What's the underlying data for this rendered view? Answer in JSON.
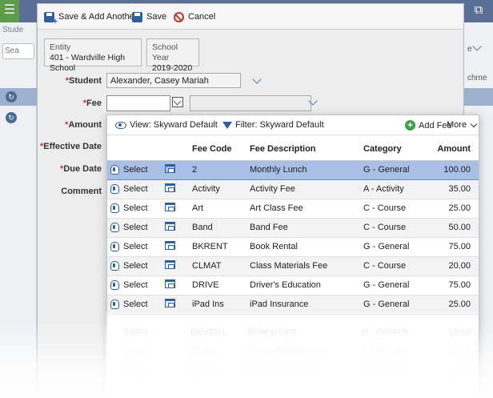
{
  "background": {
    "left_label": "Stude",
    "left_search_placeholder": "Sea",
    "right_top_text": "e",
    "right_mid_text": "chme"
  },
  "toolbar": {
    "save_add_another_label": "Save & Add Another",
    "save_label": "Save",
    "cancel_label": "Cancel"
  },
  "entity": {
    "label": "Entity",
    "value": "401 - Wardville High School"
  },
  "school_year": {
    "label": "School Year",
    "value": "2019-2020"
  },
  "form": {
    "student_label": "Student",
    "student_value": "Alexander, Casey Mariah",
    "fee_label": "Fee",
    "amount_label": "Amount",
    "effective_date_label": "Effective Date",
    "due_date_label": "Due Date",
    "comment_label": "Comment",
    "required_mark": "*"
  },
  "popup": {
    "view_label": "View: Skyward Default",
    "filter_label": "Filter: Skyward Default",
    "add_fee_label": "Add Fee",
    "more_label": "More",
    "columns": [
      "",
      "",
      "Fee Code",
      "Fee Description",
      "Category",
      "Amount"
    ],
    "select_label": "Select",
    "rows": [
      {
        "code": "2",
        "description": "Monthly Lunch",
        "category": "G - General",
        "amount": "100.00"
      },
      {
        "code": "Activity",
        "description": "Activity Fee",
        "category": "A - Activity",
        "amount": "35.00"
      },
      {
        "code": "Art",
        "description": "Art Class Fee",
        "category": "C - Course",
        "amount": "25.00"
      },
      {
        "code": "Band",
        "description": "Band Fee",
        "category": "C - Course",
        "amount": "50.00"
      },
      {
        "code": "BKRENT",
        "description": "Book Rental",
        "category": "G - General",
        "amount": "75.00"
      },
      {
        "code": "CLMAT",
        "description": "Class Materials Fee",
        "category": "C - Course",
        "amount": "20.00"
      },
      {
        "code": "DRIVE",
        "description": "Driver's Education",
        "category": "G - General",
        "amount": "75.00"
      },
      {
        "code": "iPad Ins",
        "description": "iPad Insurance",
        "category": "G - General",
        "amount": "25.00"
      }
    ]
  }
}
